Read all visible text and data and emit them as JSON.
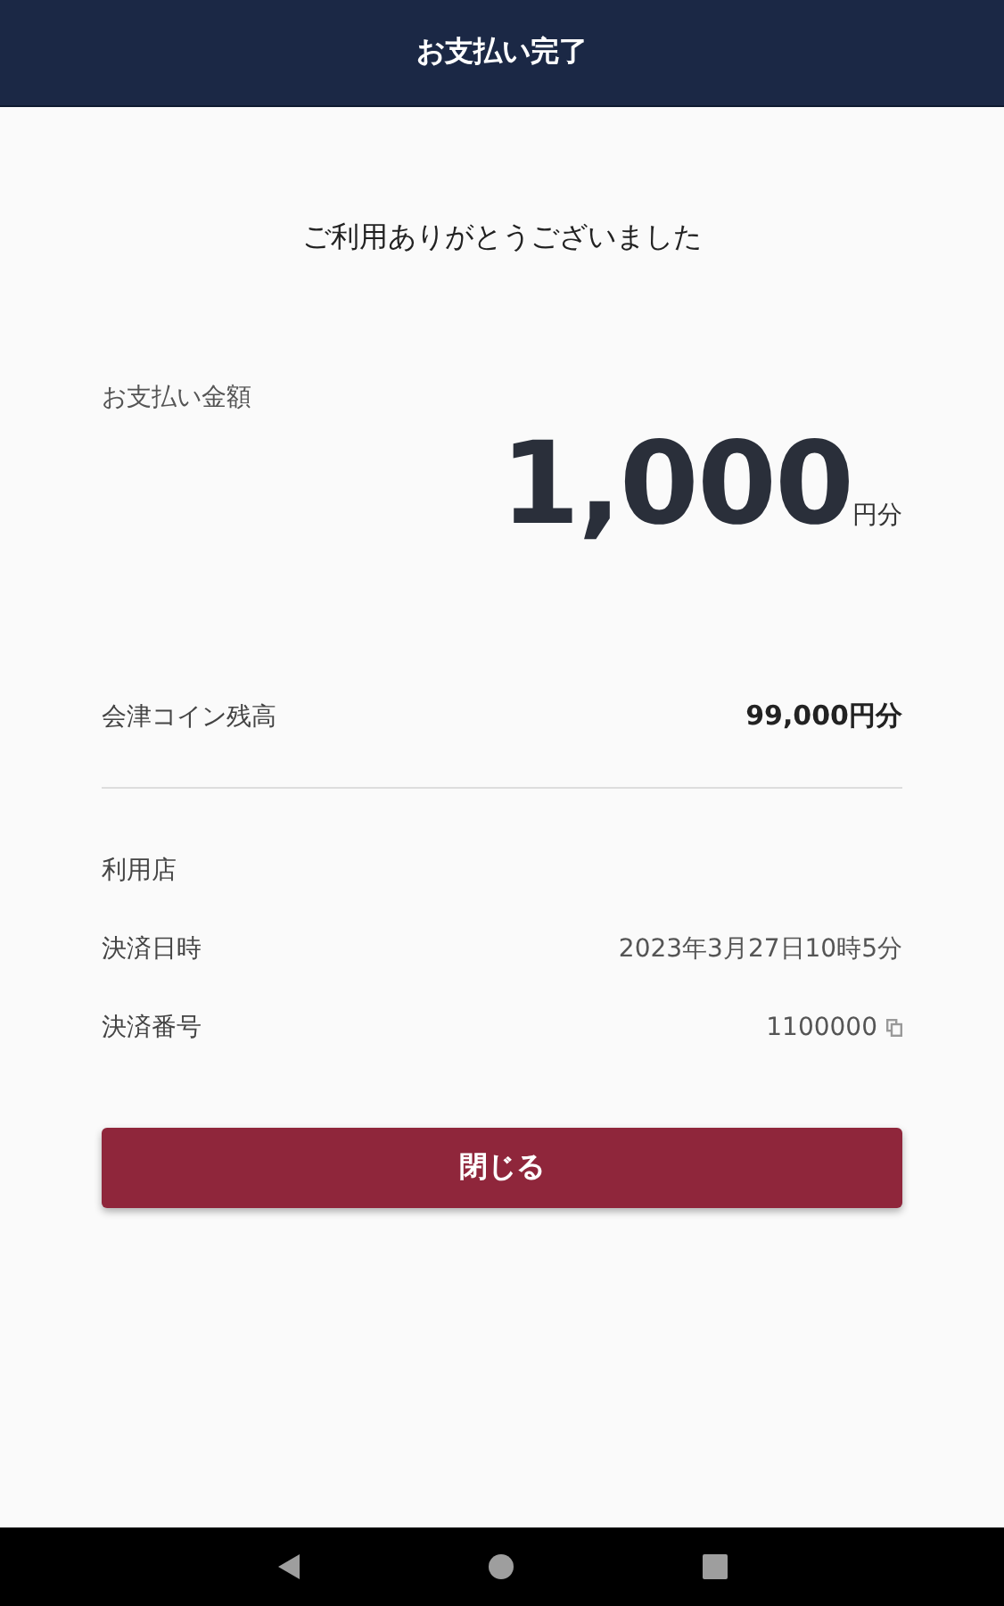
{
  "header": {
    "title": "お支払い完了"
  },
  "thanks": "ご利用ありがとうございました",
  "payment": {
    "label": "お支払い金額",
    "amount": "1,000",
    "unit": "円分"
  },
  "balance": {
    "label": "会津コイン残高",
    "value": "99,000円分"
  },
  "details": [
    {
      "label": "利用店",
      "copyable": false
    },
    {
      "label": "決済日時",
      "value": "2023年3月27日10時5分",
      "copyable": false
    },
    {
      "label": "決済番号",
      "value": "1100000",
      "copyable": true
    }
  ],
  "close_button": "閉じる"
}
